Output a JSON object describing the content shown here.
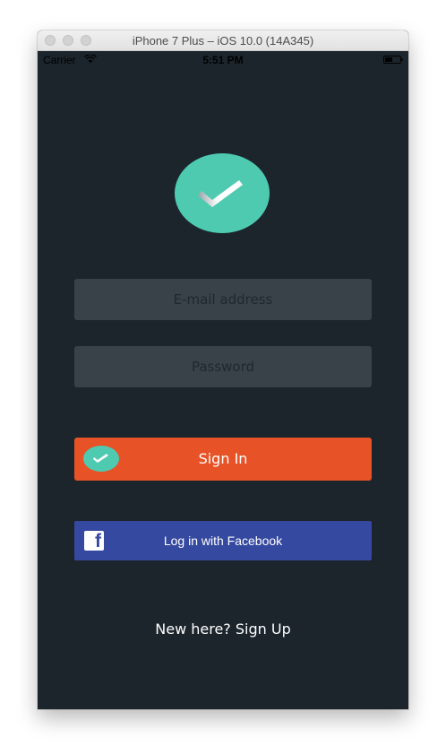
{
  "window": {
    "title": "iPhone 7 Plus – iOS 10.0 (14A345)"
  },
  "status_bar": {
    "carrier": "Carrier",
    "time": "5:51 PM"
  },
  "login": {
    "email_placeholder": "E-mail address",
    "password_placeholder": "Password",
    "sign_in_label": "Sign In",
    "facebook_label": "Log in with Facebook",
    "signup_prompt": "New here? Sign Up"
  },
  "colors": {
    "background": "#1c252c",
    "accent_green": "#4ecab1",
    "sign_in_orange": "#e75226",
    "facebook_blue": "#3649a0",
    "field_gray": "#3a4249"
  },
  "icons": [
    "wifi-icon",
    "battery-icon",
    "checkmark-icon",
    "facebook-icon"
  ]
}
